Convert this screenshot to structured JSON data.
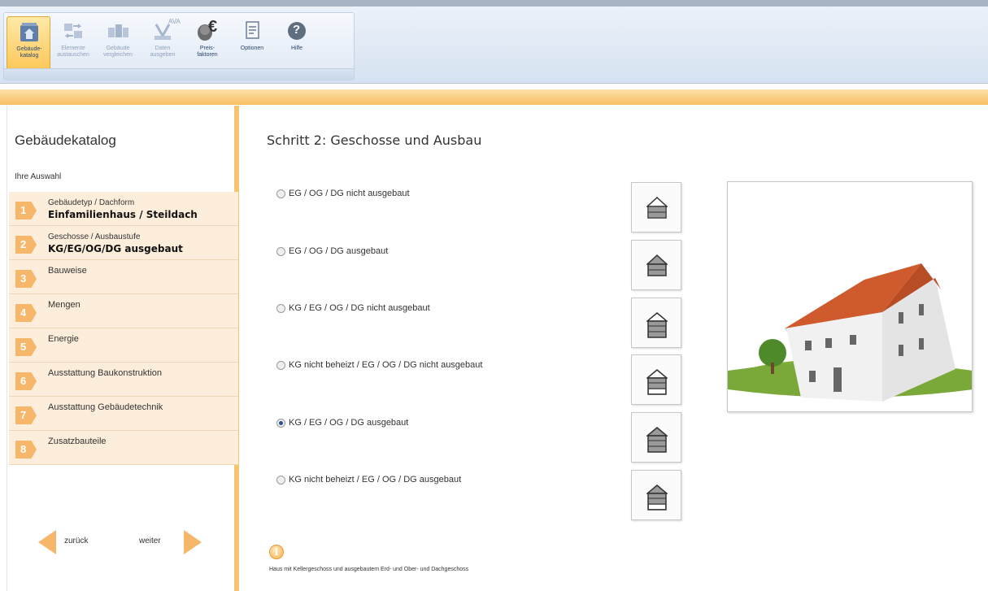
{
  "ribbon": {
    "buttons": [
      {
        "label": "Gebäude-\nkatalog",
        "icon": "building-catalog-icon",
        "state": "active"
      },
      {
        "label": "Elemente\naustauschen",
        "icon": "exchange-elements-icon",
        "state": "disabled"
      },
      {
        "label": "Gebäude\nvergleichen",
        "icon": "compare-buildings-icon",
        "state": "disabled"
      },
      {
        "label": "Daten\nausgeben",
        "icon": "export-data-ava-icon",
        "state": "disabled"
      },
      {
        "label": "Preis-\nfaktoren",
        "icon": "price-factors-euro-icon",
        "state": "enabled"
      },
      {
        "label": "Optionen",
        "icon": "options-icon",
        "state": "enabled"
      },
      {
        "label": "Hilfe",
        "icon": "help-icon",
        "state": "enabled"
      }
    ],
    "ava_text": "AVA",
    "euro_text": "€",
    "help_text": "?"
  },
  "sidebar": {
    "title": "Gebäudekatalog",
    "subtitle": "Ihre Auswahl",
    "steps": [
      {
        "num": "1",
        "label": "Gebäudetyp / Dachform",
        "value": "Einfamilienhaus / Steildach"
      },
      {
        "num": "2",
        "label": "Geschosse / Ausbaustufe",
        "value": "KG/EG/OG/DG ausgebaut"
      },
      {
        "num": "3",
        "label": "Bauweise",
        "value": ""
      },
      {
        "num": "4",
        "label": "Mengen",
        "value": ""
      },
      {
        "num": "5",
        "label": "Energie",
        "value": ""
      },
      {
        "num": "6",
        "label": "Ausstattung Baukonstruktion",
        "value": ""
      },
      {
        "num": "7",
        "label": "Ausstattung Gebäudetechnik",
        "value": ""
      },
      {
        "num": "8",
        "label": "Zusatzbauteile",
        "value": ""
      }
    ],
    "back_label": "zurück",
    "next_label": "weiter"
  },
  "main": {
    "title": "Schritt 2: Geschosse und Ausbau",
    "options": [
      {
        "label": "EG / OG / DG nicht ausgebaut",
        "checked": false
      },
      {
        "label": "EG / OG / DG ausgebaut",
        "checked": false
      },
      {
        "label": "KG / EG / OG / DG nicht ausgebaut",
        "checked": false
      },
      {
        "label": "KG nicht beheizt / EG / OG / DG nicht ausgebaut",
        "checked": false
      },
      {
        "label": "KG / EG / OG / DG ausgebaut",
        "checked": true
      },
      {
        "label": "KG nicht beheizt / EG / OG / DG ausgebaut",
        "checked": false
      }
    ],
    "info_icon": "i",
    "info_text": "Haus mit Kellergeschoss und ausgebautem Erd- und Ober- und Dachgeschoss"
  },
  "colors": {
    "accent_orange": "#f7b76a",
    "step_bg": "#fdeedc",
    "ribbon_blue": "#d6e2f1"
  }
}
